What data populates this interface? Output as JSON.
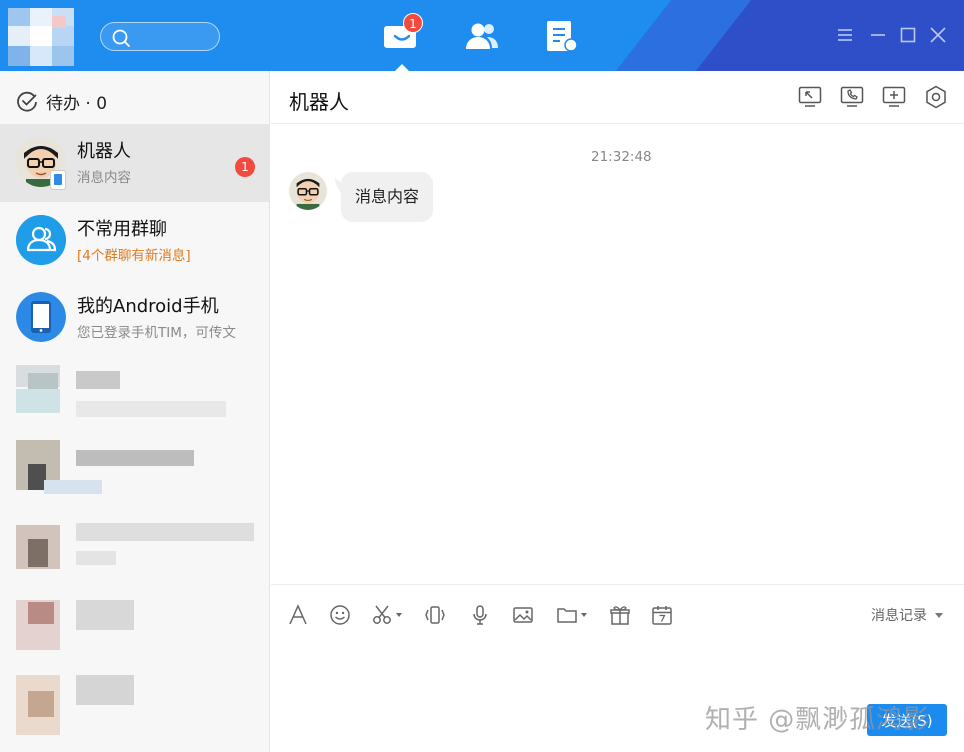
{
  "topbar": {
    "nav_badge": "1",
    "icons": [
      "chat-bubble-icon",
      "contacts-icon",
      "documents-icon"
    ],
    "window_controls": [
      "menu-icon",
      "minimize-icon",
      "maximize-icon",
      "close-icon"
    ]
  },
  "sidebar": {
    "todo_label": "待办 · 0",
    "chats": [
      {
        "name": "机器人",
        "preview": "消息内容",
        "unread": "1"
      },
      {
        "name": "不常用群聊",
        "preview": "[4个群聊有新消息]"
      },
      {
        "name": "我的Android手机",
        "preview": "您已登录手机TIM，可传文"
      }
    ]
  },
  "chat": {
    "title": "机器人",
    "header_icons": [
      "screen-share-icon",
      "phone-call-icon",
      "add-member-icon",
      "settings-hexagon-icon"
    ],
    "messages": [
      {
        "time": "21:32:48",
        "text": "消息内容"
      }
    ]
  },
  "input": {
    "tools": [
      "font-icon",
      "emoji-icon",
      "scissors-icon",
      "shake-icon",
      "microphone-icon",
      "image-icon",
      "folder-icon",
      "gift-icon",
      "calendar-icon"
    ],
    "history_label": "消息记录",
    "send_label": "发送(S)"
  },
  "watermark": "知乎 @飘渺孤鸿影",
  "colors": {
    "brand_blue": "#1f8cf0",
    "badge_red": "#f24a3e",
    "group_orange": "#e07a1e"
  }
}
